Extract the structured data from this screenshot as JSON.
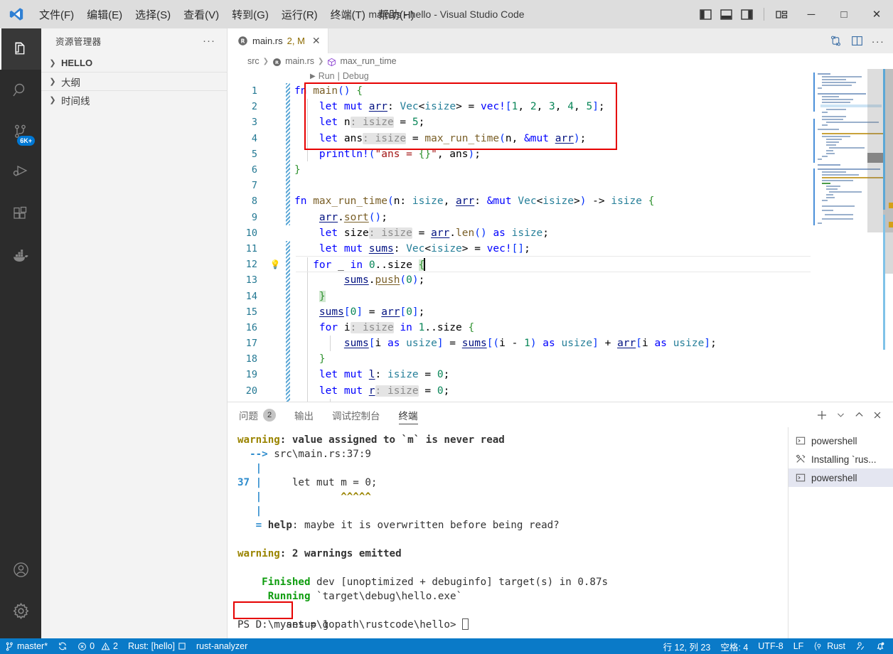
{
  "titlebar": {
    "app_title": "main.rs - hello - Visual Studio Code",
    "menus": [
      {
        "label": "文件(F)"
      },
      {
        "label": "编辑(E)"
      },
      {
        "label": "选择(S)"
      },
      {
        "label": "查看(V)"
      },
      {
        "label": "转到(G)"
      },
      {
        "label": "运行(R)"
      },
      {
        "label": "终端(T)"
      },
      {
        "label": "帮助(H)"
      }
    ],
    "layout_buttons": [
      "toggle-primary-sidebar",
      "toggle-panel",
      "toggle-secondary-sidebar",
      "customize-layout"
    ],
    "window_buttons": {
      "minimize": "─",
      "maximize": "□",
      "close": "✕"
    }
  },
  "activitybar": {
    "items": [
      {
        "name": "explorer",
        "badge": ""
      },
      {
        "name": "search",
        "badge": ""
      },
      {
        "name": "source-control",
        "badge": "6K+"
      },
      {
        "name": "run-and-debug",
        "badge": ""
      },
      {
        "name": "extensions",
        "badge": ""
      },
      {
        "name": "docker",
        "badge": ""
      }
    ],
    "bottom": [
      {
        "name": "accounts"
      },
      {
        "name": "manage-settings"
      }
    ]
  },
  "sidebar": {
    "title": "资源管理器",
    "more_actions": "···",
    "sections": [
      {
        "label": "HELLO",
        "expanded": false
      },
      {
        "label": "大纲",
        "expanded": false
      },
      {
        "label": "时间线",
        "expanded": false
      }
    ]
  },
  "editor": {
    "tab": {
      "filename": "main.rs",
      "annotation": "2, M",
      "close": "✕"
    },
    "tab_actions": [
      "open-changes-icon",
      "split-editor-icon",
      "more-actions-icon"
    ],
    "breadcrumb": [
      "src",
      "main.rs",
      "max_run_time"
    ],
    "codelens": {
      "run": "Run",
      "sep": "|",
      "debug": "Debug"
    },
    "lines": [
      {
        "num": "1",
        "text": "fn main() {"
      },
      {
        "num": "2",
        "text": "    let mut arr: Vec<isize> = vec![1, 2, 3, 4, 5];"
      },
      {
        "num": "3",
        "text": "    let n: isize = 5;"
      },
      {
        "num": "4",
        "text": "    let ans: isize = max_run_time(n, &mut arr);"
      },
      {
        "num": "5",
        "text": "    println!(\"ans = {}\", ans);"
      },
      {
        "num": "6",
        "text": "}"
      },
      {
        "num": "7",
        "text": ""
      },
      {
        "num": "8",
        "text": "fn max_run_time(n: isize, arr: &mut Vec<isize>) -> isize {"
      },
      {
        "num": "9",
        "text": "    arr.sort();"
      },
      {
        "num": "10",
        "text": "    let size: isize = arr.len() as isize;"
      },
      {
        "num": "11",
        "text": "    let mut sums: Vec<isize> = vec![];"
      },
      {
        "num": "12",
        "text": "    for _ in 0..size {"
      },
      {
        "num": "13",
        "text": "        sums.push(0);"
      },
      {
        "num": "14",
        "text": "    }"
      },
      {
        "num": "15",
        "text": "    sums[0] = arr[0];"
      },
      {
        "num": "16",
        "text": "    for i: isize in 1..size {"
      },
      {
        "num": "17",
        "text": "        sums[i as usize] = sums[(i - 1) as usize] + arr[i as usize];"
      },
      {
        "num": "18",
        "text": "    }"
      },
      {
        "num": "19",
        "text": "    let mut l: isize = 0;"
      },
      {
        "num": "20",
        "text": "    let mut r: isize = 0;"
      }
    ],
    "highlight_box_label": "red-annotation-box-lines-2-to-5",
    "lightbulb_line": "12",
    "accent_red": "#e60000"
  },
  "panel": {
    "tabs": [
      {
        "label": "问题",
        "badge": "2",
        "active": false
      },
      {
        "label": "输出",
        "badge": "",
        "active": false
      },
      {
        "label": "调试控制台",
        "badge": "",
        "active": false
      },
      {
        "label": "终端",
        "badge": "",
        "active": true
      }
    ],
    "actions": [
      "new-terminal-icon",
      "chevron-down-icon",
      "maximize-panel-icon",
      "close-panel-icon"
    ],
    "terminal_lines": [
      {
        "segments": [
          {
            "t": "warning",
            "c": "warn"
          },
          {
            "t": ": value assigned to `m` is never read",
            "c": "bold"
          }
        ]
      },
      {
        "segments": [
          {
            "t": "  ",
            "c": ""
          },
          {
            "t": "-->",
            "c": "blue"
          },
          {
            "t": " src\\main.rs:37:9",
            "c": ""
          }
        ]
      },
      {
        "segments": [
          {
            "t": "   ",
            "c": ""
          },
          {
            "t": "|",
            "c": "blue"
          }
        ]
      },
      {
        "segments": [
          {
            "t": "37 ",
            "c": "blue"
          },
          {
            "t": "|",
            "c": "blue"
          },
          {
            "t": "     let mut m = 0;",
            "c": ""
          }
        ]
      },
      {
        "segments": [
          {
            "t": "   ",
            "c": ""
          },
          {
            "t": "|",
            "c": "blue"
          },
          {
            "t": "             ^^^^^",
            "c": "warn"
          }
        ]
      },
      {
        "segments": [
          {
            "t": "   ",
            "c": ""
          },
          {
            "t": "|",
            "c": "blue"
          }
        ]
      },
      {
        "segments": [
          {
            "t": "   ",
            "c": ""
          },
          {
            "t": "=",
            "c": "blue"
          },
          {
            "t": " help",
            "c": "bold"
          },
          {
            "t": ": maybe it is overwritten before being read?",
            "c": ""
          }
        ]
      },
      {
        "segments": [
          {
            "t": "",
            "c": ""
          }
        ]
      },
      {
        "segments": [
          {
            "t": "warning",
            "c": "warn"
          },
          {
            "t": ": 2 warnings emitted",
            "c": "bold"
          }
        ]
      },
      {
        "segments": [
          {
            "t": "",
            "c": ""
          }
        ]
      },
      {
        "segments": [
          {
            "t": "    Finished",
            "c": "green"
          },
          {
            "t": " dev [unoptimized + debuginfo] target(s) in 0.87s",
            "c": ""
          }
        ]
      },
      {
        "segments": [
          {
            "t": "     Running",
            "c": "green"
          },
          {
            "t": " `target\\debug\\hello.exe`",
            "c": ""
          }
        ]
      },
      {
        "segments": [
          {
            "t": "ans = 1",
            "c": ""
          }
        ]
      },
      {
        "segments": [
          {
            "t": "PS D:\\mysetup\\gopath\\rustcode\\hello> ",
            "c": ""
          }
        ]
      }
    ],
    "terminal_output_highlight": "ans = 1",
    "terminal_list": [
      {
        "label": "powershell",
        "icon": "terminal-icon",
        "selected": false
      },
      {
        "label": "Installing `rus...",
        "icon": "tools-icon",
        "selected": false
      },
      {
        "label": "powershell",
        "icon": "terminal-icon",
        "selected": true
      }
    ]
  },
  "statusbar": {
    "branch": "master*",
    "sync_icon": "sync-icon",
    "errors": "0",
    "warnings": "2",
    "rust_project": "Rust: [hello]",
    "rust_analyzer": "rust-analyzer",
    "cursor_position": "行 12, 列 23",
    "indentation": "空格: 4",
    "encoding": "UTF-8",
    "eol": "LF",
    "language": "Rust",
    "feedback_icon": "feedback-icon",
    "bell_icon": "bell-dot-icon",
    "background": "#0a7ac8"
  }
}
